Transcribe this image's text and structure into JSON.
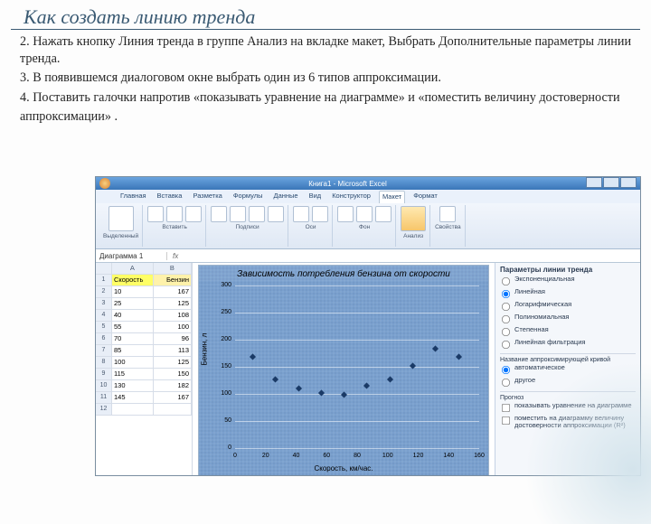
{
  "slide": {
    "title": "Как создать линию тренда",
    "p1": "2. Нажать кнопку Линия тренда в группе Анализ на вкладке макет, Выбрать Дополнительные параметры линии тренда.",
    "p2": "3.  В появившемся диалоговом окне выбрать один из 6 типов аппроксимации.",
    "p3": "4. Поставить галочки напротив «показывать уравнение на диаграмме» и «поместить величину достоверности",
    "p4": "аппроксимации» ."
  },
  "excel": {
    "titlebar": "Книга1 - Microsoft Excel",
    "tabs": [
      "Главная",
      "Вставка",
      "Разметка",
      "Формулы",
      "Данные",
      "Вид",
      "Конструктор",
      "Макет",
      "Формат"
    ],
    "namebox": "Диаграмма 1",
    "fx": "fx",
    "table": {
      "headers": [
        "",
        "A",
        "B"
      ],
      "h1": "Скорость, км/ч",
      "h2": "Бензин, л",
      "rows": [
        [
          "1",
          "Скорость",
          "Бензин"
        ],
        [
          "2",
          "10",
          "167"
        ],
        [
          "3",
          "25",
          "125"
        ],
        [
          "4",
          "40",
          "108"
        ],
        [
          "5",
          "55",
          "100"
        ],
        [
          "6",
          "70",
          "96"
        ],
        [
          "7",
          "85",
          "113"
        ],
        [
          "8",
          "100",
          "125"
        ],
        [
          "9",
          "115",
          "150"
        ],
        [
          "10",
          "130",
          "182"
        ],
        [
          "11",
          "145",
          "167"
        ],
        [
          "12",
          "",
          ""
        ]
      ]
    },
    "panel": {
      "title": "Параметры линии тренда",
      "opts": [
        "Экспоненциальная",
        "Линейная",
        "Логарифмическая",
        "Полиномиальная",
        "Степенная",
        "Линейная фильтрация"
      ],
      "name_section": "Название аппроксимирующей кривой",
      "name_auto": "автоматическое",
      "name_other": "другое",
      "forecast": "Прогноз",
      "chk1": "показывать уравнение на диаграмме",
      "chk2": "поместить на диаграмму величину достоверности аппроксимации (R²)"
    }
  },
  "chart_data": {
    "type": "scatter",
    "title": "Зависимость потребления бензина от скорости",
    "xlabel": "Скорость, км/час.",
    "ylabel": "Бензин, л",
    "x": [
      10,
      25,
      40,
      55,
      70,
      85,
      100,
      115,
      130,
      145
    ],
    "y": [
      167,
      125,
      108,
      100,
      96,
      113,
      125,
      150,
      182,
      167
    ],
    "xlim": [
      0,
      160
    ],
    "ylim": [
      0,
      300
    ],
    "yticks": [
      0,
      50,
      100,
      150,
      200,
      250,
      300
    ],
    "xticks": [
      0,
      20,
      40,
      60,
      80,
      100,
      120,
      140,
      160
    ]
  }
}
